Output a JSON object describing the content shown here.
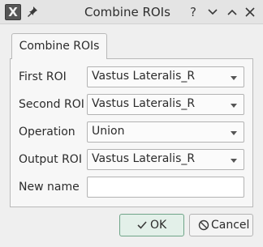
{
  "window": {
    "title": "Combine ROIs",
    "app_icon_glyph": "X",
    "controls": {
      "help": "?",
      "minimize": "⌄",
      "maximize": "⌃",
      "close": "✕"
    }
  },
  "tab": {
    "label": "Combine ROIs"
  },
  "form": {
    "first_roi": {
      "label": "First ROI",
      "value": "Vastus Lateralis_R"
    },
    "second_roi": {
      "label": "Second ROI",
      "value": "Vastus Lateralis_R"
    },
    "operation": {
      "label": "Operation",
      "value": "Union"
    },
    "output_roi": {
      "label": "Output ROI",
      "value": "Vastus Lateralis_R"
    },
    "new_name": {
      "label": "New name",
      "value": ""
    }
  },
  "buttons": {
    "ok": "OK",
    "cancel": "Cancel"
  },
  "icons": {
    "pin": "pin-icon",
    "ok": "check-icon",
    "cancel": "cancel-icon"
  },
  "colors": {
    "ok_border": "#6fa488",
    "ok_bg": "#e3f0e9"
  }
}
